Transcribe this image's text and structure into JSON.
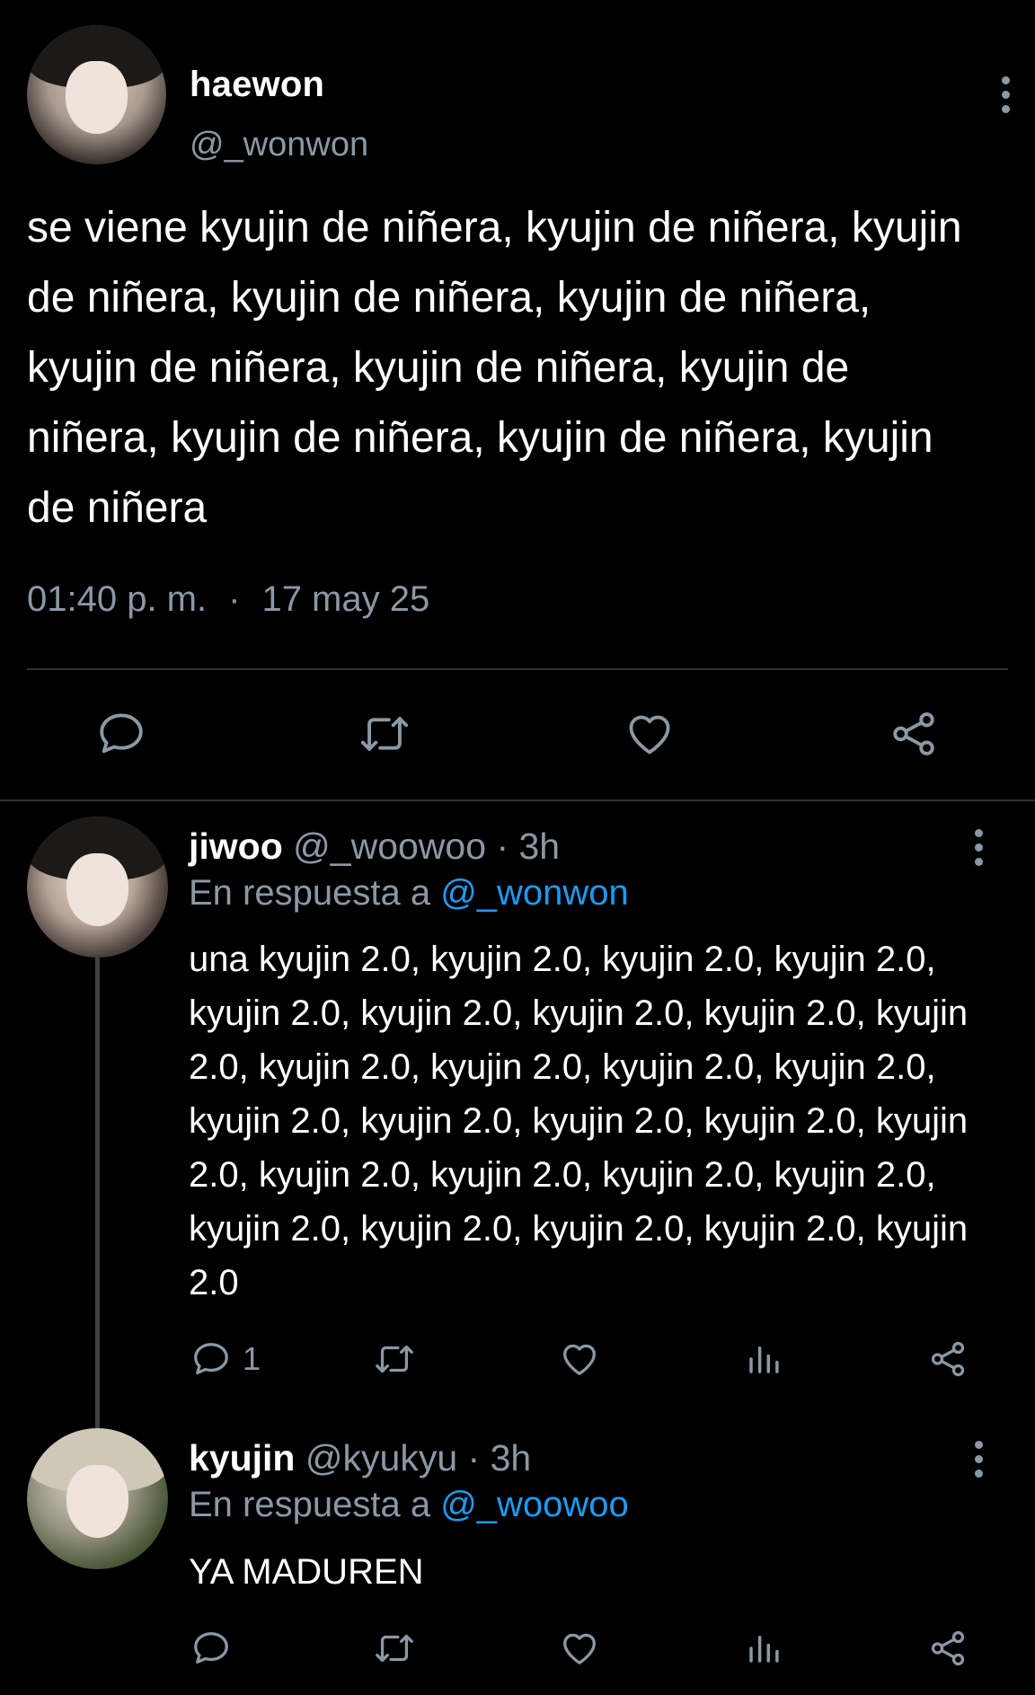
{
  "main_tweet": {
    "display_name": "haewon",
    "handle": "@_wonwon",
    "text": "se viene kyujin de niñera, kyujin de niñera, kyujin de niñera, kyujin de niñera, kyujin de niñera, kyujin de niñera, kyujin de niñera, kyujin de niñera, kyujin de niñera, kyujin de niñera, kyujin de niñera",
    "time": "01:40 p. m.",
    "separator": "·",
    "date": "17 may 25",
    "icons": [
      "reply-icon",
      "retweet-icon",
      "like-icon",
      "share-icon"
    ]
  },
  "replies": [
    {
      "display_name": "jiwoo",
      "handle": "@_woowoo",
      "age": "· 3h",
      "reply_prefix": "En respuesta a",
      "reply_to": "@_wonwon",
      "text": "una kyujin 2.0, kyujin 2.0, kyujin 2.0, kyujin 2.0, kyujin 2.0, kyujin 2.0, kyujin 2.0, kyujin 2.0, kyujin 2.0, kyujin 2.0, kyujin 2.0, kyujin 2.0, kyujin 2.0, kyujin 2.0, kyujin 2.0, kyujin 2.0, kyujin 2.0, kyujin 2.0, kyujin 2.0, kyujin 2.0, kyujin 2.0, kyujin 2.0, kyujin 2.0, kyujin 2.0, kyujin 2.0, kyujin 2.0, kyujin 2.0",
      "reply_count": "1"
    },
    {
      "display_name": "kyujin",
      "handle": "@kyukyu",
      "age": "· 3h",
      "reply_prefix": "En respuesta a",
      "reply_to": "@_woowoo",
      "text": "YA MADUREN",
      "reply_count": ""
    }
  ],
  "colors": {
    "background": "#000000",
    "text": "#ffffff",
    "secondary": "#8b98a5",
    "accent": "#1d9bf0",
    "divider": "#2f3336"
  }
}
